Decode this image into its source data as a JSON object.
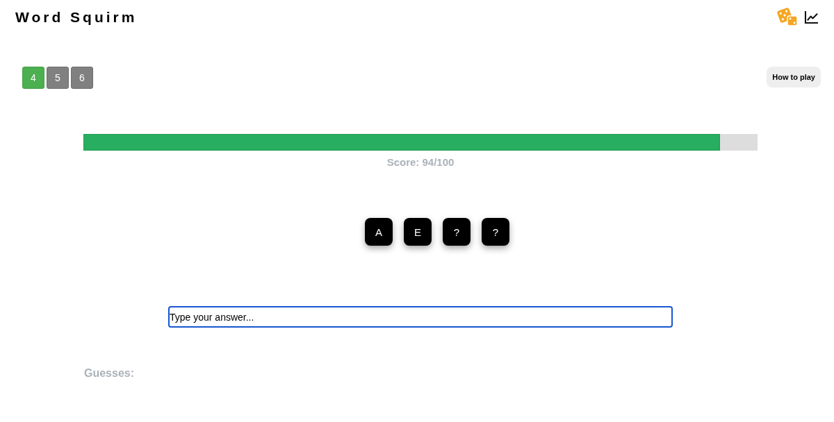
{
  "header": {
    "title": "Word Squirm"
  },
  "levels": [
    {
      "label": "4",
      "selected": true
    },
    {
      "label": "5",
      "selected": false
    },
    {
      "label": "6",
      "selected": false
    }
  ],
  "help_button": {
    "label": "How to play"
  },
  "progress": {
    "level": 0.944
  },
  "score": "Score: 94/100",
  "tiles": [
    {
      "letter": "A"
    },
    {
      "letter": "E"
    },
    {
      "letter": "?"
    },
    {
      "letter": "?"
    }
  ],
  "answer_field": {
    "placeholder": "Type your answer...",
    "focused": true
  },
  "guesses": {
    "label": "Guesses:"
  }
}
